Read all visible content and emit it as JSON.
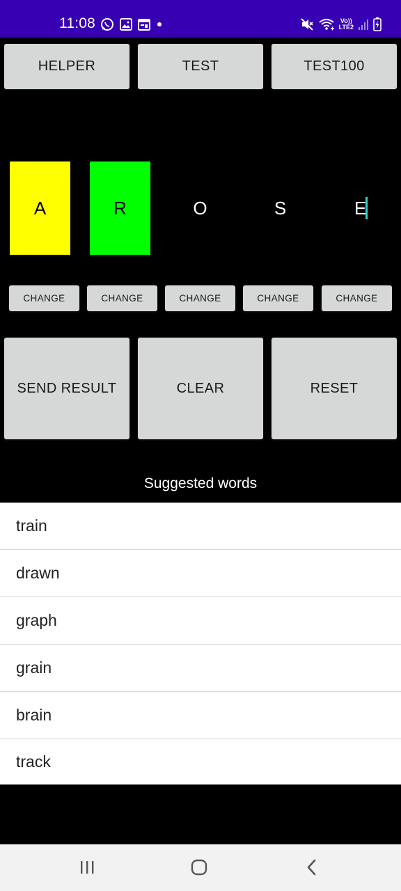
{
  "status_bar": {
    "time": "11:08",
    "left_icons": [
      "whatsapp-icon",
      "image-icon",
      "calendar-icon",
      "dot-icon"
    ],
    "right_icons": [
      "mute-icon",
      "wifi-calling-icon",
      "volte-icon",
      "signal-icon",
      "battery-charging-icon"
    ],
    "volte_line1": "Vo))",
    "volte_line2": "LTE2",
    "color": "#3700b3"
  },
  "top_buttons": {
    "helper": "HELPER",
    "test": "TEST",
    "test100": "TEST100"
  },
  "tiles": [
    {
      "letter": "A",
      "state": "yellow"
    },
    {
      "letter": "R",
      "state": "green"
    },
    {
      "letter": "O",
      "state": "none"
    },
    {
      "letter": "S",
      "state": "none"
    },
    {
      "letter": "E",
      "state": "none"
    }
  ],
  "tile_colors": {
    "yellow": "#ffff00",
    "green": "#00ff00"
  },
  "change_label": "CHANGE",
  "actions": {
    "send_result": "SEND RESULT",
    "clear": "CLEAR",
    "reset": "RESET"
  },
  "suggested_title": "Suggested words",
  "suggested_words": [
    "train",
    "drawn",
    "graph",
    "grain",
    "brain",
    "track"
  ],
  "nav_bar": {
    "icons": [
      "recent-apps-icon",
      "home-icon",
      "back-icon"
    ]
  }
}
